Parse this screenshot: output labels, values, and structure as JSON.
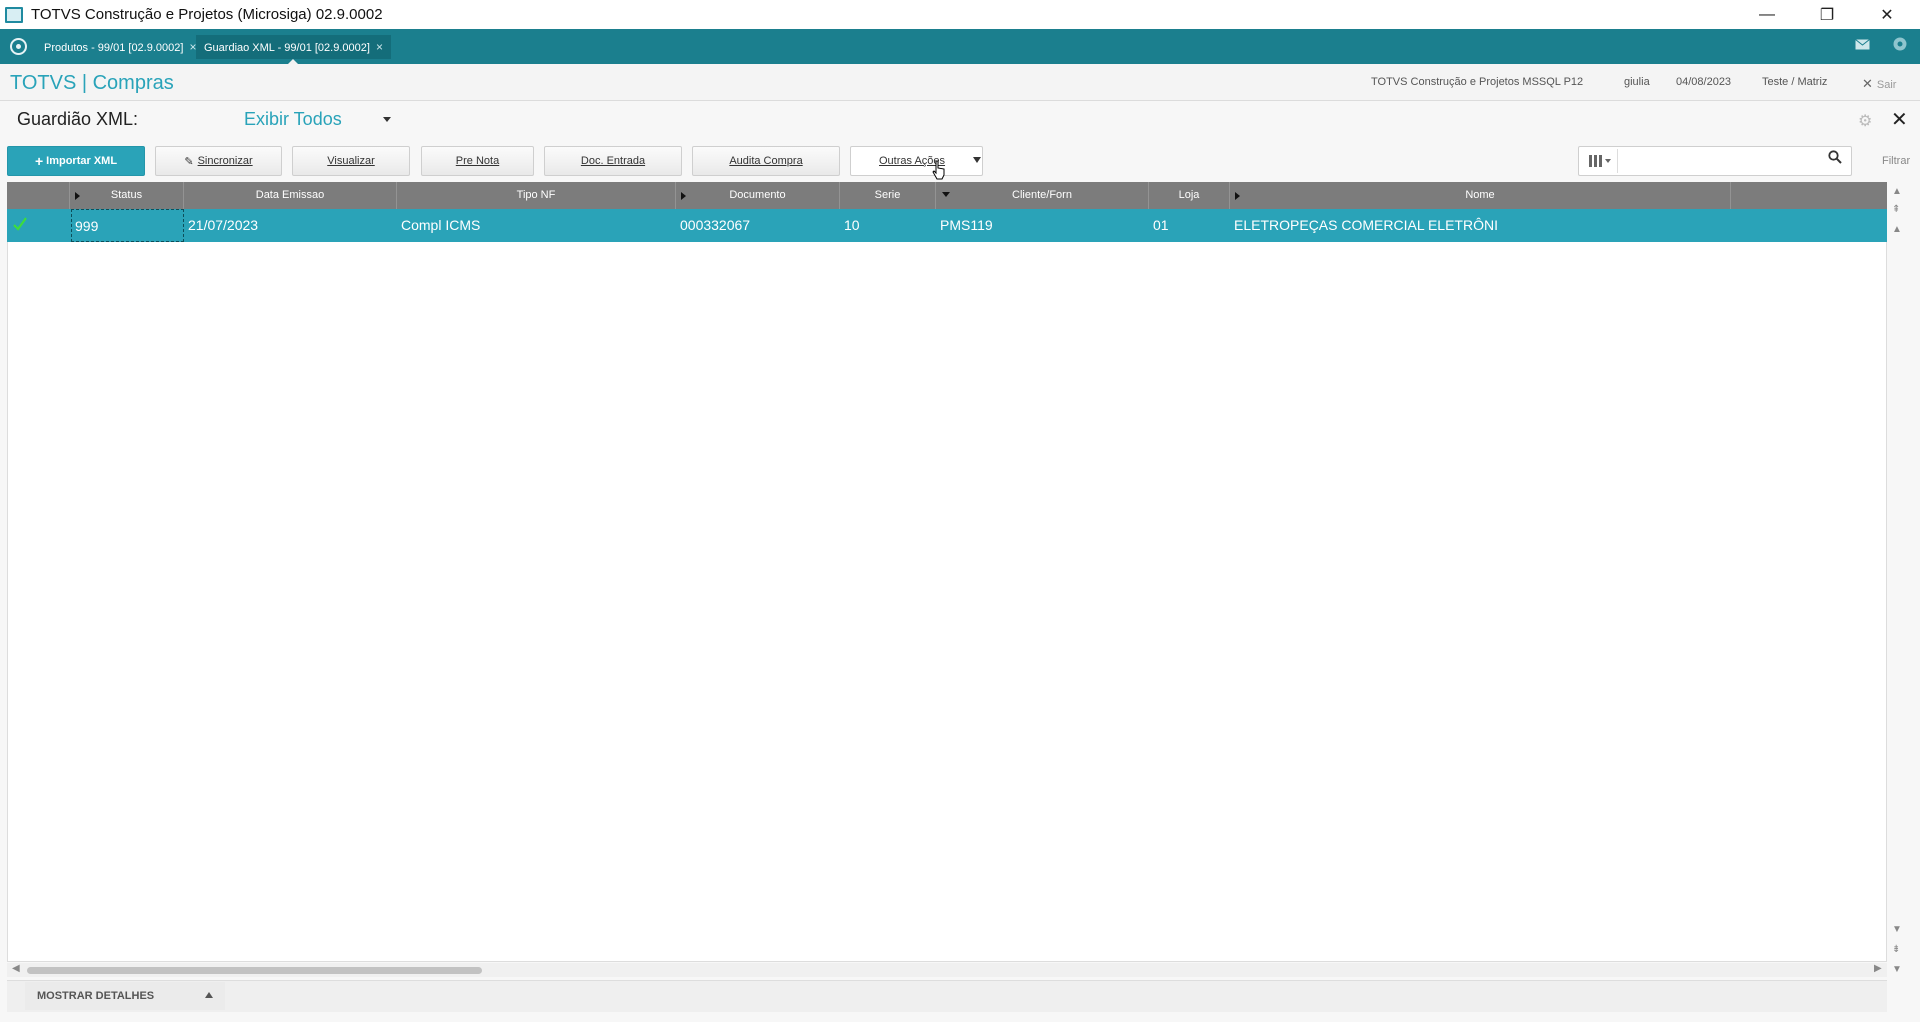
{
  "window": {
    "title": "TOTVS Construção e Projetos (Microsiga) 02.9.0002",
    "minimize": "—",
    "restore": "❐",
    "close": "✕"
  },
  "tabs": [
    {
      "label": "Produtos - 99/01 [02.9.0002]",
      "close": "×"
    },
    {
      "label": "Guardiao XML - 99/01 [02.9.0002]",
      "close": "×"
    }
  ],
  "header": {
    "brand": "TOTVS | Compras",
    "company": "TOTVS Construção e Projetos MSSQL P12",
    "user": "giulia",
    "date": "04/08/2023",
    "branch": "Teste / Matriz",
    "exit": "Sair"
  },
  "page": {
    "title": "Guardião XML:",
    "filter": "Exibir Todos"
  },
  "toolbar": {
    "importar": "Importar XML",
    "sincronizar": "Sincronizar",
    "visualizar": "Visualizar",
    "pre_nota": "Pre Nota",
    "doc_entrada": "Doc. Entrada",
    "audita_compra": "Audita Compra",
    "outras_acoes": "Outras Ações",
    "filtrar": "Filtrar",
    "search_value": ""
  },
  "grid": {
    "columns": [
      "Status",
      "Data Emissao",
      "Tipo NF",
      "Documento",
      "Serie",
      "Cliente/Forn",
      "Loja",
      "Nome"
    ],
    "rows": [
      {
        "status": "999",
        "data_emissao": "21/07/2023",
        "tipo_nf": "Compl ICMS",
        "documento": "000332067",
        "serie": "10",
        "cliente_forn": "PMS119",
        "loja": "01",
        "nome": "ELETROPEÇAS COMERCIAL ELETRÔNI"
      }
    ]
  },
  "footer": {
    "details": "MOSTRAR DETALHES"
  },
  "colors": {
    "accent": "#2aa3b8",
    "tabbar": "#1b7f8e",
    "grid_header": "#7c7c7c"
  }
}
